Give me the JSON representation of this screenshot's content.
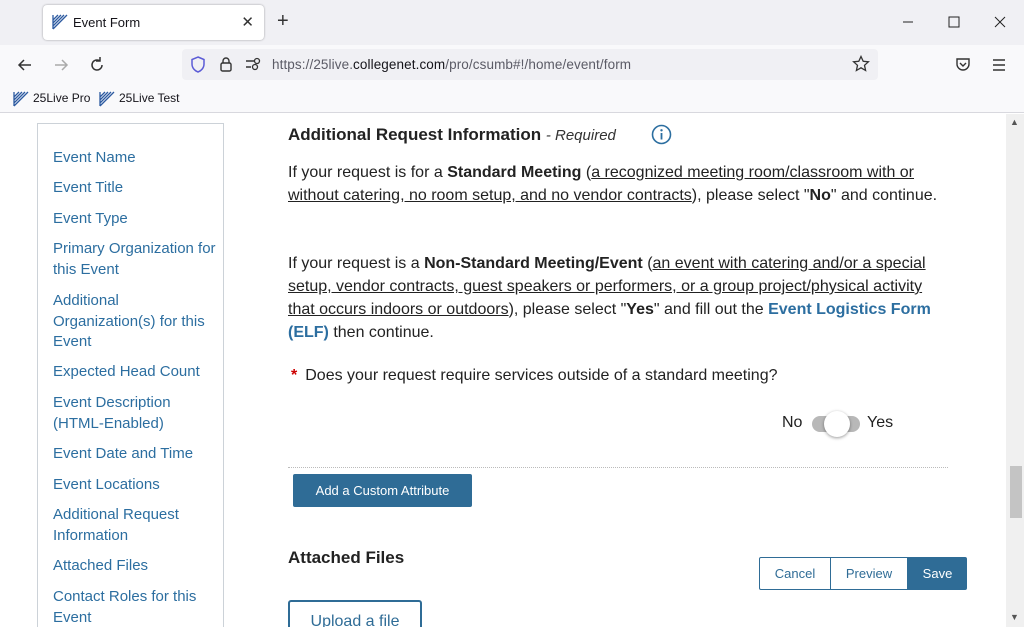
{
  "browser": {
    "tab_title": "Event Form",
    "url_prefix": "https://25live.",
    "url_host": "collegenet.com",
    "url_path": "/pro/csumb#!/home/event/form",
    "bookmarks": [
      "25Live Pro",
      "25Live Test"
    ]
  },
  "sidebar": {
    "items": [
      {
        "label": "Event Name"
      },
      {
        "label": "Event Title"
      },
      {
        "label": "Event Type"
      },
      {
        "label": "Primary Organization for this Event"
      },
      {
        "label": "Additional Organization(s) for this Event"
      },
      {
        "label": "Expected Head Count"
      },
      {
        "label": "Event Description (HTML-Enabled)"
      },
      {
        "label": "Event Date and Time"
      },
      {
        "label": "Event Locations"
      },
      {
        "label": "Additional Request Information"
      },
      {
        "label": "Attached Files"
      },
      {
        "label": "Contact Roles for this Event"
      }
    ]
  },
  "section": {
    "title": "Additional Request Information",
    "required": "- Required",
    "para1": {
      "t1": "If your request is for a ",
      "b1": "Standard Meeting",
      "t2": " (",
      "u1": "a recognized meeting room/classroom with or without catering, no room setup, and no vendor contracts",
      "t3": "), please select \"",
      "b2": "No",
      "t4": "\" and continue."
    },
    "para2": {
      "t1": "If your request is a ",
      "b1": "Non-Standard Meeting/Event",
      "t2": " (",
      "u1": "an event with catering and/or a special setup, vendor contracts, guest speakers or performers, or a group project/physical activity that occurs indoors or outdoors",
      "t3": "), please select \"",
      "b2": "Yes",
      "t4": "\" and fill out the ",
      "link": "Event Logistics Form (ELF)",
      "t5": " then continue."
    },
    "question": "Does your request require services outside of a standard meeting?",
    "toggle_no": "No",
    "toggle_yes": "Yes",
    "toggle_value": "No"
  },
  "custom_attribute_button": "Add a Custom Attribute",
  "attached_files": {
    "title": "Attached Files",
    "upload_label": "Upload a file"
  },
  "actions": {
    "cancel": "Cancel",
    "preview": "Preview",
    "save": "Save"
  },
  "colors": {
    "link": "#2c6ea0",
    "primary_button": "#2f6c96",
    "required_star": "#cc0000"
  }
}
